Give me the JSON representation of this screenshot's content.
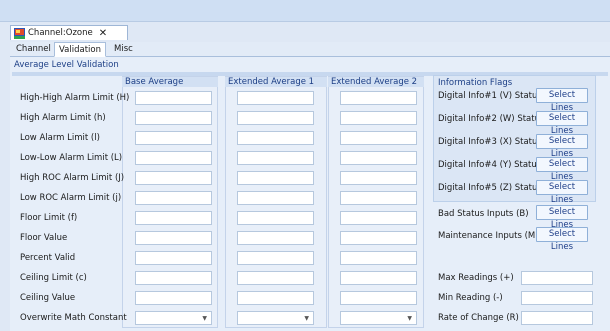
{
  "document_tab": {
    "label": "Channel:Ozone",
    "close": "✕"
  },
  "tabs": [
    {
      "label": "Channel"
    },
    {
      "label": "Validation"
    },
    {
      "label": "Misc"
    }
  ],
  "section_title": "Average Level Validation",
  "columns": [
    {
      "header": "Base Average"
    },
    {
      "header": "Extended Average 1"
    },
    {
      "header": "Extended Average 2"
    }
  ],
  "rows": [
    {
      "label": "High-High Alarm Limit (H)"
    },
    {
      "label": "High Alarm Limit (h)"
    },
    {
      "label": "Low Alarm Limit (l)"
    },
    {
      "label": "Low-Low Alarm Limit (L)"
    },
    {
      "label": "High ROC Alarm Limit (J)"
    },
    {
      "label": "Low ROC Alarm Limit (j)"
    },
    {
      "label": "Floor Limit (f)"
    },
    {
      "label": "Floor Value"
    },
    {
      "label": "Percent Valid"
    },
    {
      "label": "Ceiling Limit (c)"
    },
    {
      "label": "Ceiling Value"
    },
    {
      "label": "Overwrite Math Constant"
    }
  ],
  "combo_arrow": "▼",
  "information_flags": {
    "title": "Information Flags",
    "items": [
      {
        "label": "Digital Info#1 (V) Status",
        "button": "Select Lines"
      },
      {
        "label": "Digital Info#2 (W) Status",
        "button": "Select Lines"
      },
      {
        "label": "Digital Info#3 (X) Status",
        "button": "Select Lines"
      },
      {
        "label": "Digital Info#4 (Y) Status",
        "button": "Select Lines"
      },
      {
        "label": "Digital Info#5 (Z) Status",
        "button": "Select Lines"
      }
    ]
  },
  "extra_flags": [
    {
      "label": "Bad Status Inputs (B)",
      "button": "Select Lines"
    },
    {
      "label": "Maintenance Inputs (M)",
      "button": "Select Lines"
    }
  ],
  "readings": [
    {
      "label": "Max Readings (+)"
    },
    {
      "label": "Min Reading (-)"
    },
    {
      "label": "Rate of Change (R)"
    }
  ],
  "colors": {
    "accent": "#1d3f86",
    "panel": "#e6eef9",
    "field_border": "#b6c8de"
  },
  "icons": {
    "channel": "channel-window-icon"
  }
}
